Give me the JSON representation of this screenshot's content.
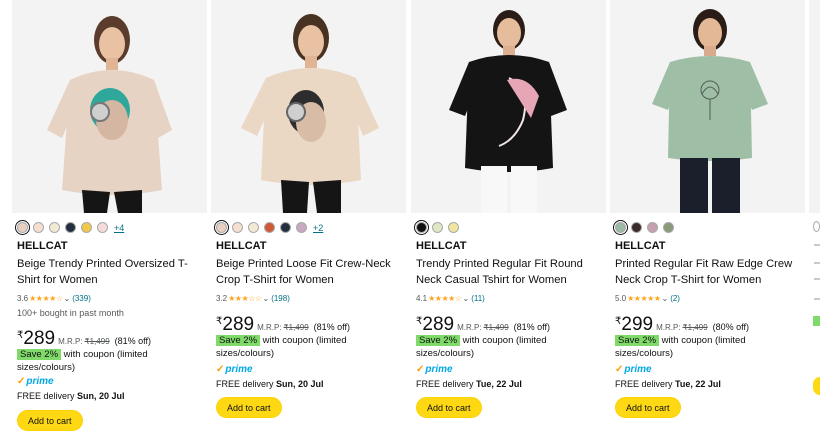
{
  "products": [
    {
      "swatches": [
        "#e8cfc2",
        "#f4dfd0",
        "#f2ead4",
        "#232f3e",
        "#f0c94c",
        "#f4dcdc"
      ],
      "more_colours": "+4",
      "brand": "HELLCAT",
      "title": "Beige Trendy Printed Oversized T-Shirt for Women",
      "rating": "3.6",
      "stars": "★★★★☆",
      "reviews": "(339)",
      "bought": "100+ bought in past month",
      "currency": "₹",
      "price": "289",
      "mrp_label": "M.R.P:",
      "mrp": "₹1,499",
      "discount": "(81% off)",
      "save_badge": "Save 2%",
      "coupon_text": "with coupon (limited sizes/colours)",
      "prime": "prime",
      "delivery_prefix": "FREE delivery",
      "delivery_date": "Sun, 20 Jul",
      "cart_label": "Add to cart",
      "shirt_color": "#e7d3c4"
    },
    {
      "swatches": [
        "#e8cfc2",
        "#f4dfd0",
        "#f2ead4",
        "#cf5a3a",
        "#232f3e",
        "#c9a8c2"
      ],
      "more_colours": "+2",
      "brand": "HELLCAT",
      "title": "Beige Printed Loose Fit Crew-Neck Crop T-Shirt for Women",
      "rating": "3.2",
      "stars": "★★★☆☆",
      "reviews": "(198)",
      "bought": "",
      "currency": "₹",
      "price": "289",
      "mrp_label": "M.R.P:",
      "mrp": "₹1,499",
      "discount": "(81% off)",
      "save_badge": "Save 2%",
      "coupon_text": "with coupon (limited sizes/colours)",
      "prime": "prime",
      "delivery_prefix": "FREE delivery",
      "delivery_date": "Sun, 20 Jul",
      "cart_label": "Add to cart",
      "shirt_color": "#ead8c5"
    },
    {
      "swatches": [
        "#111111",
        "#dde7c4",
        "#f0e6a0"
      ],
      "more_colours": "",
      "brand": "HELLCAT",
      "title": "Trendy Printed Regular Fit Round Neck Casual Tshirt for Women",
      "rating": "4.1",
      "stars": "★★★★☆",
      "reviews": "(11)",
      "bought": "",
      "currency": "₹",
      "price": "289",
      "mrp_label": "M.R.P:",
      "mrp": "₹1,499",
      "discount": "(81% off)",
      "save_badge": "Save 2%",
      "coupon_text": "with coupon (limited sizes/colours)",
      "prime": "prime",
      "delivery_prefix": "FREE delivery",
      "delivery_date": "Tue, 22 Jul",
      "cart_label": "Add to cart",
      "shirt_color": "#141414"
    },
    {
      "swatches": [
        "#9cbba5",
        "#3a2a2a",
        "#c7a0b0",
        "#8a9a7a"
      ],
      "more_colours": "",
      "brand": "HELLCAT",
      "title": "Printed Regular Fit Raw Edge Crew Neck Crop T-Shirt for Women",
      "rating": "5.0",
      "stars": "★★★★★",
      "reviews": "(2)",
      "bought": "",
      "currency": "₹",
      "price": "299",
      "mrp_label": "M.R.P:",
      "mrp": "₹1,499",
      "discount": "(80% off)",
      "save_badge": "Save 2%",
      "coupon_text": "with coupon (limited sizes/colours)",
      "prime": "prime",
      "delivery_prefix": "FREE delivery",
      "delivery_date": "Tue, 22 Jul",
      "cart_label": "Add to cart",
      "shirt_color": "#9fbea6"
    }
  ],
  "colors": {
    "accent_link": "#007185",
    "star": "#ffa41c",
    "save_badge": "#7fda69",
    "prime": "#00a8e1",
    "cart_button": "#ffd814"
  }
}
